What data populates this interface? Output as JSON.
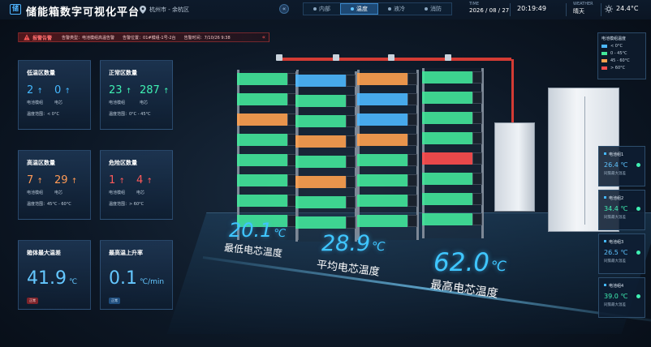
{
  "header": {
    "logo_text": "储",
    "title": "储能箱数字可视化平台",
    "location": "杭州市 - 余杭区",
    "collapse_icon": "«",
    "tabs": [
      {
        "label": "内部",
        "active": false
      },
      {
        "label": "温度",
        "active": true
      },
      {
        "label": "液冷",
        "active": false
      },
      {
        "label": "消防",
        "active": false
      }
    ],
    "time_label": "TIME",
    "date": "2026 / 08 / 27",
    "time": "20:19:49",
    "weather_label": "WEATHER",
    "weather": "晴天",
    "temperature": "24.4°C"
  },
  "alarm": {
    "title": "报警告警",
    "items": [
      "告警类型：电池模组高温告警",
      "告警位置：01#模组-1号-2台",
      "告警时间：7/10/26 9:38"
    ],
    "chevron": "«"
  },
  "cards": {
    "low": {
      "title": "低温区数量",
      "module_count": "2",
      "cell_count": "0",
      "module_label": "电池模组",
      "cell_label": "电芯",
      "range": "温度范围：< 0°C"
    },
    "normal": {
      "title": "正常区数量",
      "module_count": "23",
      "cell_count": "287",
      "module_label": "电池模组",
      "cell_label": "电芯",
      "range": "温度范围：0°C - 45°C"
    },
    "high": {
      "title": "高温区数量",
      "module_count": "7",
      "cell_count": "29",
      "module_label": "电池模组",
      "cell_label": "电芯",
      "range": "温度范围：45°C - 60°C"
    },
    "danger": {
      "title": "危险区数量",
      "module_count": "1",
      "cell_count": "4",
      "module_label": "电池模组",
      "cell_label": "电芯",
      "range": "温度范围：> 60°C"
    },
    "max_diff": {
      "title": "箱体最大温差",
      "value": "41.9",
      "unit": "℃",
      "badge": "正常"
    },
    "max_rise": {
      "title": "最高温上升率",
      "value": "0.1",
      "unit": "℃/min",
      "badge": "正常"
    }
  },
  "arrows": {
    "up": "↑"
  },
  "big_temps": {
    "min": {
      "value": "20.1",
      "unit": "℃",
      "label": "最低电芯温度"
    },
    "avg": {
      "value": "28.9",
      "unit": "℃",
      "label": "平均电芯温度"
    },
    "max": {
      "value": "62.0",
      "unit": "℃",
      "label": "最高电芯温度"
    }
  },
  "legend": {
    "title": "电池模组温度",
    "items": [
      {
        "label": "< 0°C",
        "color": "#4db8ff"
      },
      {
        "label": "0 - 45°C",
        "color": "#43e79a"
      },
      {
        "label": "45 - 60°C",
        "color": "#ffa14f"
      },
      {
        "label": "> 60°C",
        "color": "#ff4d4d"
      }
    ]
  },
  "side_cards": [
    {
      "title": "电池组1",
      "value": "26.4 ℃",
      "sub": "同簇最大温差"
    },
    {
      "title": "电池组2",
      "value": "34.4 ℃",
      "sub": "同簇最大温差"
    },
    {
      "title": "电池组3",
      "value": "26.5 ℃",
      "sub": "同簇最大温差"
    },
    {
      "title": "电池组4",
      "value": "39.0 ℃",
      "sub": "同簇最大温差"
    }
  ],
  "colors": {
    "blue": "#4db8ff",
    "green": "#43e79a",
    "orange": "#ffa14f",
    "red": "#ff4d4d"
  },
  "racks": [
    [
      "green",
      "green",
      "orange",
      "green",
      "green",
      "green",
      "green",
      "green"
    ],
    [
      "blue",
      "green",
      "green",
      "orange",
      "green",
      "orange",
      "green",
      "green"
    ],
    [
      "orange",
      "blue",
      "blue",
      "orange",
      "green",
      "green",
      "green",
      "green"
    ],
    [
      "green",
      "green",
      "green",
      "green",
      "red",
      "green",
      "green",
      "green"
    ]
  ]
}
